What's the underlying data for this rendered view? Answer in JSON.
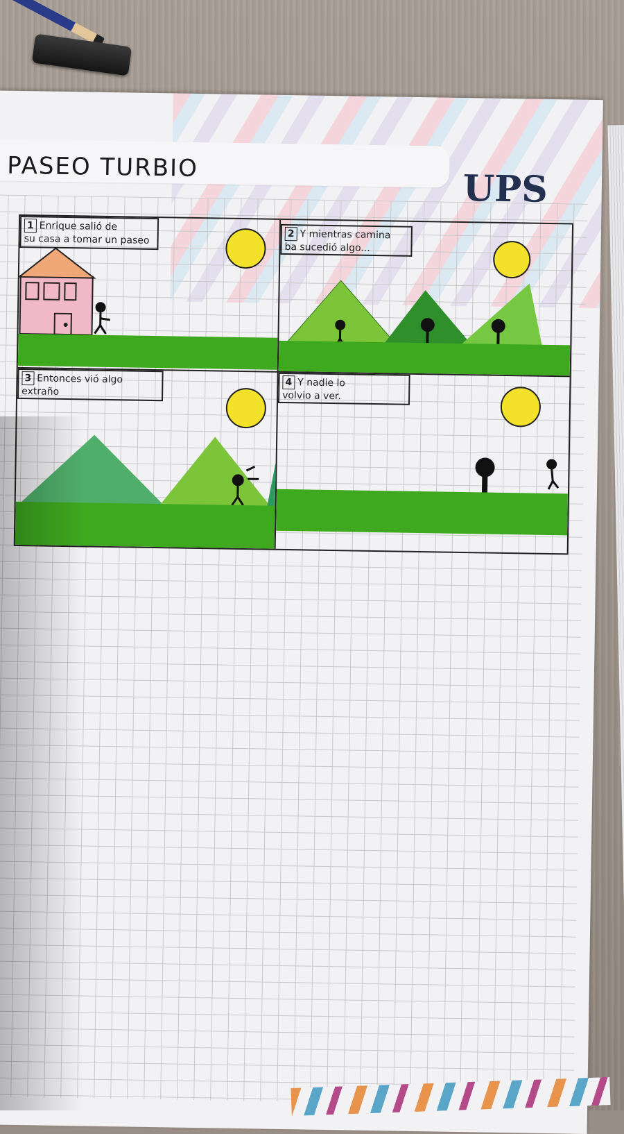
{
  "page": {
    "title": "PASEO TURBIO",
    "brand": "UPS"
  },
  "panels": [
    {
      "number": "1",
      "caption_line1": "Enrique salió de",
      "caption_line2": "su casa a tomar un paseo"
    },
    {
      "number": "2",
      "caption_line1": "Y mientras camina",
      "caption_line2": "ba sucedió algo..."
    },
    {
      "number": "3",
      "caption_line1": "Entonces vió algo",
      "caption_line2": "extraño"
    },
    {
      "number": "4",
      "caption_line1": "Y nadie lo",
      "caption_line2": "volvio a ver."
    }
  ],
  "colors": {
    "sun": "#f3e12a",
    "grass": "#3ea81f",
    "house_wall": "#f0b8c8",
    "house_roof": "#f0a878",
    "logo": "#23304f"
  },
  "objects": {
    "pencil": "pencil",
    "eraser": "eraser",
    "notebook": "grid-notebook-page"
  }
}
